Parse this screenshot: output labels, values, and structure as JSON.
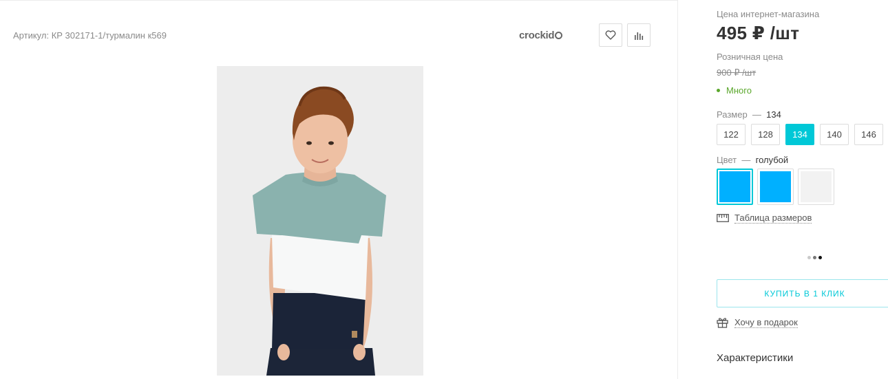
{
  "product": {
    "article": "Артикул: КР 302171-1/турмалин к569",
    "brand": "crockid"
  },
  "actions": {
    "favorite_icon": "heart-icon",
    "compare_icon": "bar-chart-icon"
  },
  "pricing": {
    "online_label": "Цена интернет-магазина",
    "online_price": "495 ₽ /шт",
    "retail_label": "Розничная цена",
    "retail_price": "900 ₽ /шт",
    "stock_text": "Много",
    "stock_color": "#5aa72b"
  },
  "size": {
    "label": "Размер",
    "dash": "—",
    "selected": "134",
    "options": [
      "122",
      "128",
      "134",
      "140",
      "146"
    ],
    "active_index": 2
  },
  "color": {
    "label": "Цвет",
    "dash": "—",
    "selected": "голубой",
    "swatches": [
      {
        "color": "#00b0ff",
        "active": true
      },
      {
        "color": "#00b0ff",
        "active": false
      },
      {
        "color": "#f2f2f2",
        "active": false
      }
    ]
  },
  "size_table_link": "Таблица размеров",
  "carousel_dots": 3,
  "carousel_active": 2,
  "buy_one_click": "КУПИТЬ В 1 КЛИК",
  "gift_link": "Хочу в подарок",
  "characteristics_title": "Характеристики",
  "accent_color": "#00c8d7"
}
